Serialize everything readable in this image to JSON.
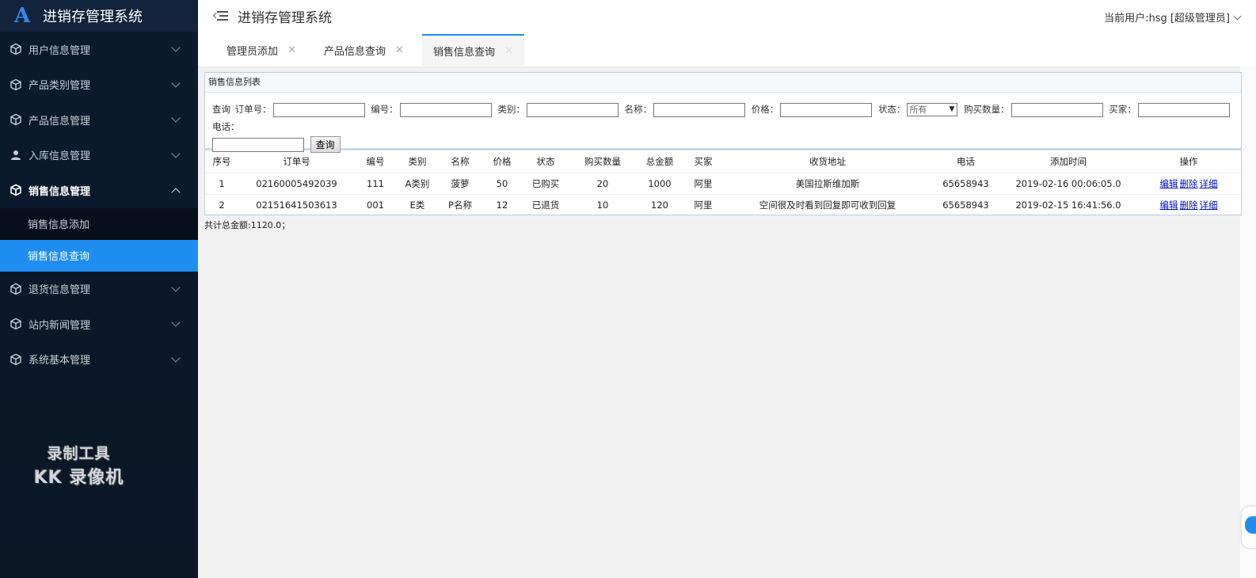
{
  "app": {
    "title": "进销存管理系统",
    "logo_text": "A",
    "current_user": "当前用户:hsg [超级管理员]"
  },
  "sidebar": {
    "items": [
      {
        "label": "用户信息管理",
        "icon": "cube-icon",
        "open": false
      },
      {
        "label": "产品类别管理",
        "icon": "cube-icon",
        "open": false
      },
      {
        "label": "产品信息管理",
        "icon": "cube-icon",
        "open": false
      },
      {
        "label": "入库信息管理",
        "icon": "user-icon",
        "open": false
      },
      {
        "label": "销售信息管理",
        "icon": "cube-icon",
        "open": true
      },
      {
        "label": "退货信息管理",
        "icon": "cube-icon",
        "open": false
      },
      {
        "label": "站内新闻管理",
        "icon": "cube-icon",
        "open": false
      },
      {
        "label": "系统基本管理",
        "icon": "cube-icon",
        "open": false
      }
    ],
    "submenu": [
      {
        "label": "销售信息添加",
        "active": false
      },
      {
        "label": "销售信息查询",
        "active": true
      }
    ]
  },
  "watermark": {
    "line1": "录制工具",
    "line2": "KK 录像机"
  },
  "tabs": [
    {
      "label": "管理员添加",
      "close": "✕",
      "active": false
    },
    {
      "label": "产品信息查询",
      "close": "✕",
      "active": false
    },
    {
      "label": "销售信息查询",
      "close": "✕",
      "active": true
    }
  ],
  "panel": {
    "title": "销售信息列表",
    "search": {
      "query_label": "查询",
      "order_label": "订单号：",
      "code_label": "编号：",
      "category_label": "类别：",
      "name_label": "名称：",
      "price_label": "价格：",
      "status_label": "状态：",
      "status_value": "所有",
      "qty_label": "购买数量：",
      "buyer_label": "买家：",
      "phone_label": "电话：",
      "button": "查询"
    },
    "columns": [
      "序号",
      "订单号",
      "编号",
      "类别",
      "名称",
      "价格",
      "状态",
      "购买数量",
      "总金额",
      "买家",
      "收货地址",
      "电话",
      "添加时间",
      "操作"
    ],
    "rows": [
      {
        "idx": "1",
        "order": "02160005492039",
        "code": "111",
        "category": "A类别",
        "name": "菠萝",
        "price": "50",
        "status": "已购买",
        "qty": "20",
        "total": "1000",
        "buyer": "阿里",
        "address": "美国拉斯维加斯",
        "phone": "65658943",
        "time": "2019-02-16 00:06:05.0"
      },
      {
        "idx": "2",
        "order": "02151641503613",
        "code": "001",
        "category": "E类",
        "name": "P名称",
        "price": "12",
        "status": "已退货",
        "qty": "10",
        "total": "120",
        "buyer": "阿里",
        "address": "空间很及时看到回复即可收到回复",
        "phone": "65658943",
        "time": "2019-02-15 16:41:56.0"
      }
    ],
    "ops": {
      "edit": "编辑",
      "delete": "删除",
      "detail": "详细"
    },
    "total_text": "共计总金额:1120.0；"
  }
}
